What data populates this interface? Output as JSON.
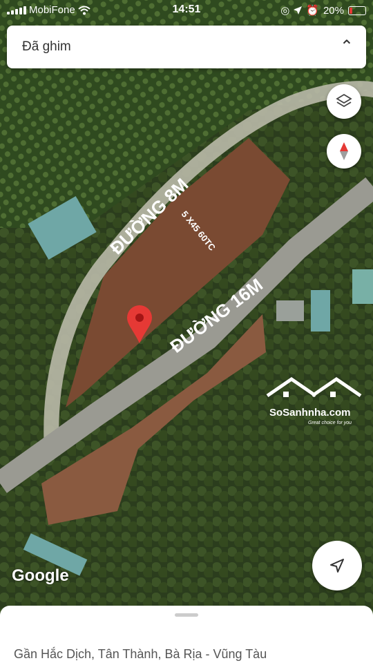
{
  "status_bar": {
    "carrier": "MobiFone",
    "time": "14:51",
    "battery_percent": "20%",
    "battery_level": 0.2
  },
  "search": {
    "text": "Đã ghim"
  },
  "map": {
    "road_label_1": "ĐƯỜNG 8M",
    "road_label_2": "ĐƯỜNG 16M",
    "lot_note": "5 X45 60TC",
    "attribution": "Google",
    "watermark_brand": "SoSanhnha.com",
    "watermark_tagline": "Great choice for you",
    "pin_color": "#e53935"
  },
  "place_sheet": {
    "address": "Gần Hắc Dịch, Tân Thành, Bà Rịa - Vũng Tàu"
  },
  "icons": [
    "wifi-icon",
    "location-arrow-icon",
    "alarm-icon",
    "layers-icon",
    "compass-icon",
    "my-location-icon",
    "map-pin-icon",
    "chevron-up-icon"
  ]
}
